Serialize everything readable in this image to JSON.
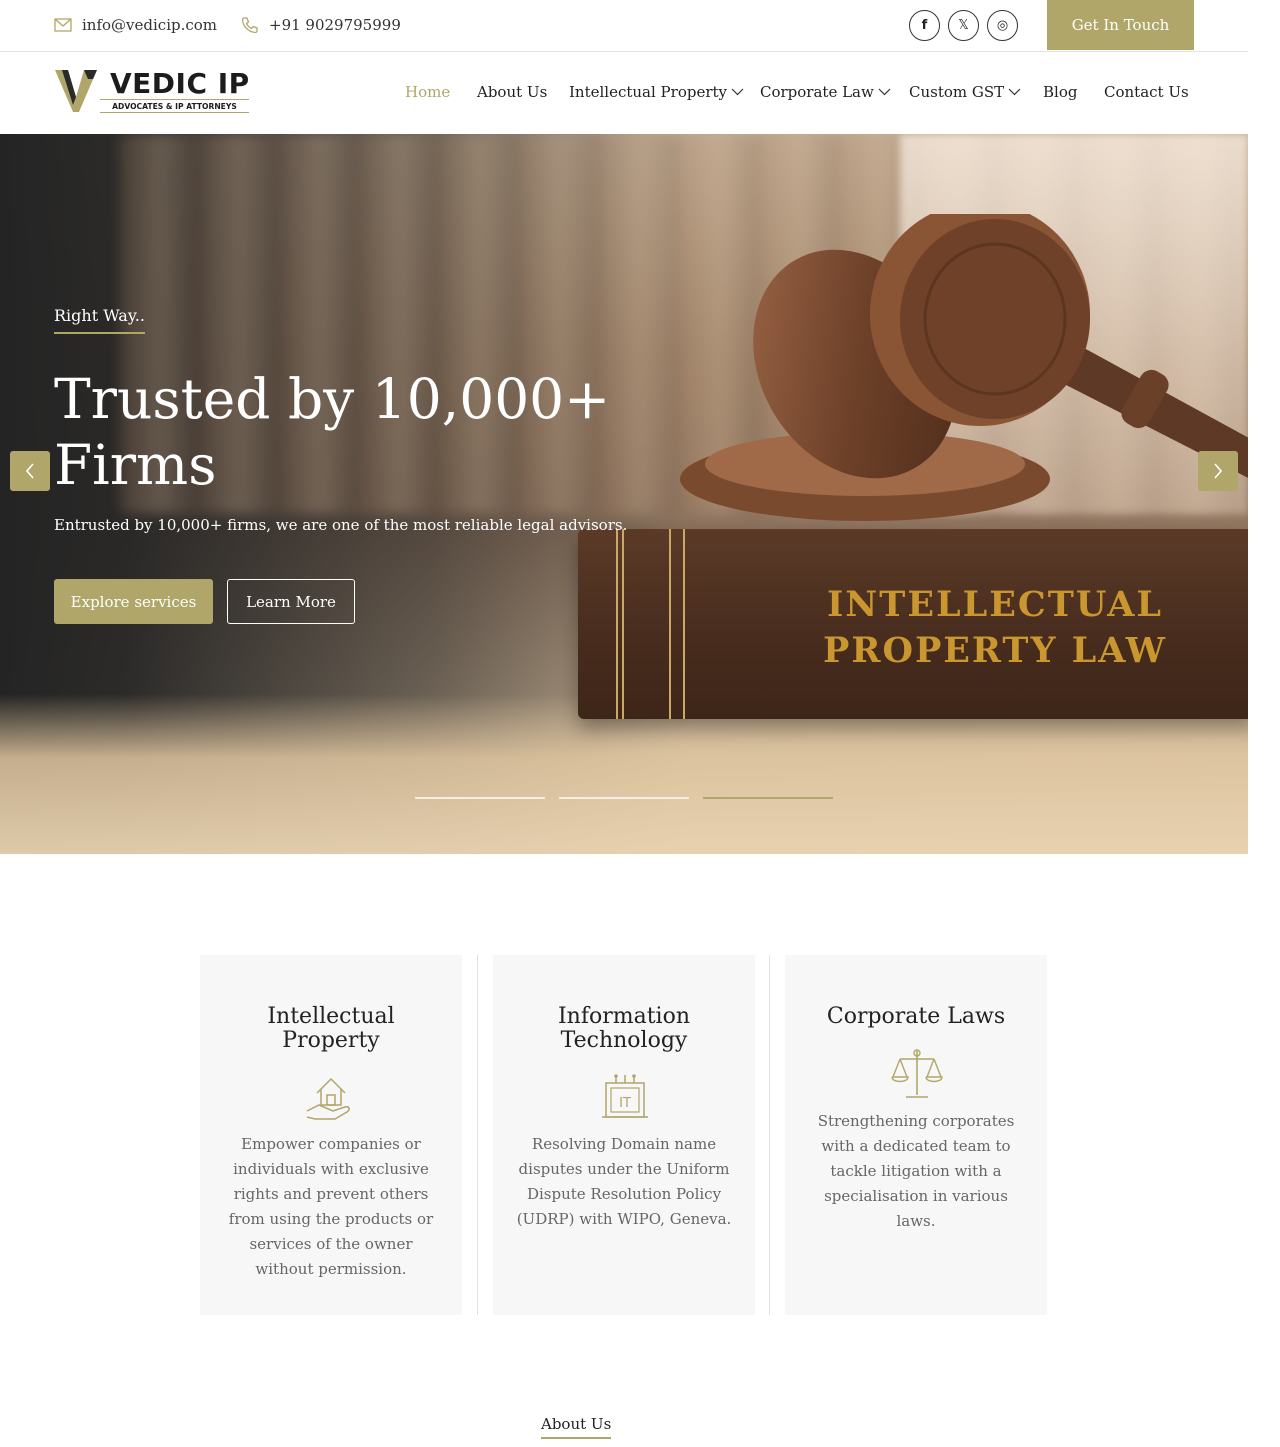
{
  "topbar": {
    "email": "info@vedicip.com",
    "phone": "+91 9029795999",
    "social": [
      {
        "icon": "facebook-icon",
        "glyph": "f"
      },
      {
        "icon": "x-twitter-icon",
        "glyph": "𝕏"
      },
      {
        "icon": "instagram-icon",
        "glyph": "◎"
      }
    ],
    "cta_label": "Get In Touch"
  },
  "logo": {
    "name": "VEDIC IP",
    "tagline": "ADVOCATES & IP ATTORNEYS"
  },
  "nav": [
    {
      "label": "Home",
      "active": true
    },
    {
      "label": "About Us"
    },
    {
      "label": "Intellectual Property",
      "dropdown": true
    },
    {
      "label": "Corporate Law",
      "dropdown": true
    },
    {
      "label": "Custom GST",
      "dropdown": true
    },
    {
      "label": "Blog"
    },
    {
      "label": "Contact Us"
    }
  ],
  "hero": {
    "kicker": "Right Way..",
    "title": "Trusted by 10,000+ Firms",
    "text": "Entrusted by 10,000+ firms, we are one of the most reliable legal advisors.",
    "primary_button": "Explore services",
    "secondary_button": "Learn More",
    "book_title": "INTELLECTUAL PROPERTY LAW",
    "slide_count": 3,
    "active_slide": 3
  },
  "cards": [
    {
      "title": "Intellectual Property",
      "icon": "house-in-hand-icon",
      "text": "Empower companies or individuals with exclusive rights and prevent others from using the products or services of the owner without permission."
    },
    {
      "title": "Information Technology",
      "icon": "it-circuit-icon",
      "text": "Resolving Domain name disputes under the Uniform Dispute Resolution Policy (UDRP) with WIPO, Geneva."
    },
    {
      "title": "Corporate Laws",
      "icon": "scales-of-justice-icon",
      "text": "Strengthening corporates with a dedicated team to tackle litigation with a specialisation in various laws."
    }
  ],
  "about_link": "About Us",
  "colors": {
    "accent": "#b1a66a",
    "dark": "#242424",
    "card_bg": "#f7f7f7"
  }
}
